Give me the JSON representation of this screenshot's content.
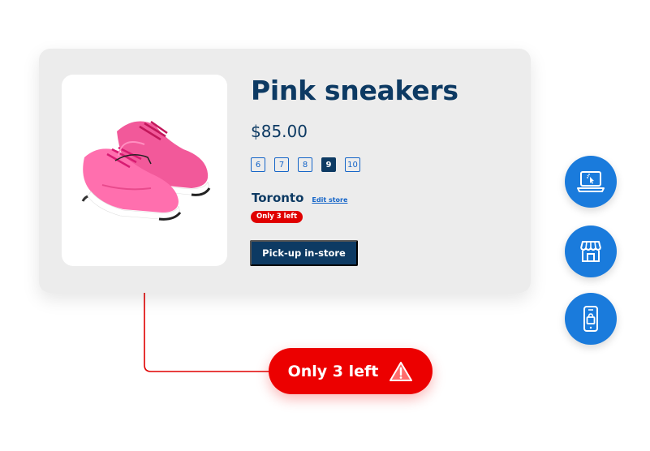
{
  "product": {
    "title": "Pink sneakers",
    "price": "$85.00",
    "image_icon": "pink-sneakers-photo"
  },
  "sizes": {
    "options": [
      "6",
      "7",
      "8",
      "9",
      "10"
    ],
    "selected": "9"
  },
  "store": {
    "name": "Toronto",
    "edit_label": "Edit store"
  },
  "stock": {
    "badge_label": "Only 3 left",
    "callout_label": "Only 3 left",
    "callout_icon": "warning-icon"
  },
  "actions": {
    "pickup_label": "Pick-up in-store"
  },
  "channels": [
    {
      "icon": "laptop-click-icon"
    },
    {
      "icon": "storefront-icon"
    },
    {
      "icon": "mobile-shopping-bag-icon"
    }
  ],
  "colors": {
    "navy": "#0d3a63",
    "link_blue": "#1565c8",
    "alert_red": "#ec0000",
    "channel_blue": "#1a7bdc",
    "card_bg": "#ececec"
  }
}
